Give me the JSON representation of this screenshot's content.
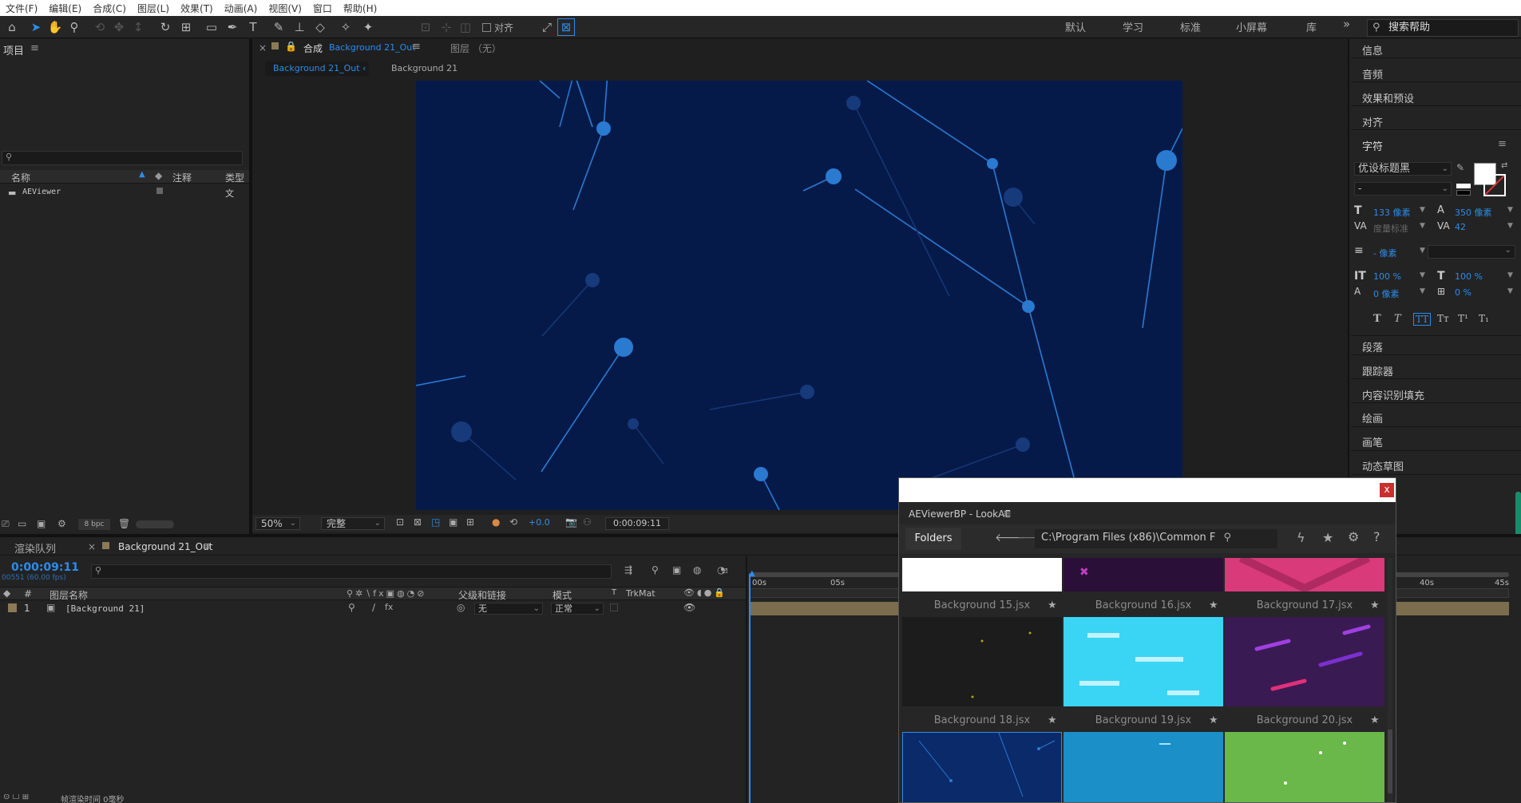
{
  "menu": [
    "文件(F)",
    "编辑(E)",
    "合成(C)",
    "图层(L)",
    "效果(T)",
    "动画(A)",
    "视图(V)",
    "窗口",
    "帮助(H)"
  ],
  "toolbar": {
    "snap_label": "对齐",
    "workspaces": [
      "默认",
      "学习",
      "标准",
      "小屏幕",
      "库"
    ],
    "more": "»",
    "search_help": "搜索帮助"
  },
  "project": {
    "title": "项目",
    "col_name": "名称",
    "col_comment": "注释",
    "col_type": "类型",
    "items": [
      {
        "name": "AEViewer",
        "type": "文"
      }
    ],
    "bpc": "8 bpc"
  },
  "comp": {
    "tab_prefix": "合成",
    "tab_name": "Background 21_Out",
    "layer_tab": "图层 （无）",
    "breadcrumbs": [
      "Background 21_Out",
      "Background 21"
    ],
    "zoom": "50%",
    "quality": "完整",
    "exposure": "+0.0",
    "timecode": "0:00:09:11"
  },
  "timeline": {
    "render_queue": "渲染队列",
    "tab_name": "Background 21_Out",
    "timecode": "0:00:09:11",
    "frames": "00551 (60.00 fps)",
    "col_layer_name": "图层名称",
    "col_parent": "父级和链接",
    "col_mode": "模式",
    "col_t": "T",
    "col_trkmat": "TrkMat",
    "col_hash": "#",
    "layers": [
      {
        "index": "1",
        "name": "[Background 21]",
        "parent": "无",
        "mode": "正常"
      }
    ],
    "ruler": [
      "00s",
      "05s",
      "40s",
      "45s"
    ],
    "bottom_hint": "帧渲染时间 0毫秒"
  },
  "right_panel": {
    "items": [
      "信息",
      "音频",
      "效果和预设",
      "对齐"
    ],
    "character": {
      "title": "字符",
      "font": "优设标题黑",
      "style": "-",
      "size": "133 像素",
      "leading": "350 像素",
      "kerning": "度量标准",
      "tracking": "42",
      "stroke": "- 像素",
      "vscale": "100 %",
      "hscale": "100 %",
      "baseline": "0 像素",
      "tsume": "0 %"
    },
    "lower_items": [
      "段落",
      "跟踪器",
      "内容识别填充",
      "绘画",
      "画笔",
      "动态草图"
    ]
  },
  "aeviewer": {
    "title": "AEViewerBP - LookAE",
    "folders_btn": "Folders",
    "path": "C:\\Program Files (x86)\\Common F",
    "close": "x",
    "items": [
      {
        "label": "Background 15.jsx",
        "color": "#ffffff"
      },
      {
        "label": "Background 16.jsx",
        "color": "#2a0f38"
      },
      {
        "label": "Background 17.jsx",
        "color": "#d83a7a"
      },
      {
        "label": "Background 18.jsx",
        "color": "#1c1c1c"
      },
      {
        "label": "Background 19.jsx",
        "color": "#3ad4f4"
      },
      {
        "label": "Background 20.jsx",
        "color": "#3a1a52"
      },
      {
        "label": "",
        "color": "#0a2a6a"
      },
      {
        "label": "",
        "color": "#1a8fc8"
      },
      {
        "label": "",
        "color": "#6ab84a"
      }
    ]
  },
  "colors": {
    "accent": "#2d8ceb",
    "canvas": "#061a4a",
    "node": "#2a7ad0"
  }
}
